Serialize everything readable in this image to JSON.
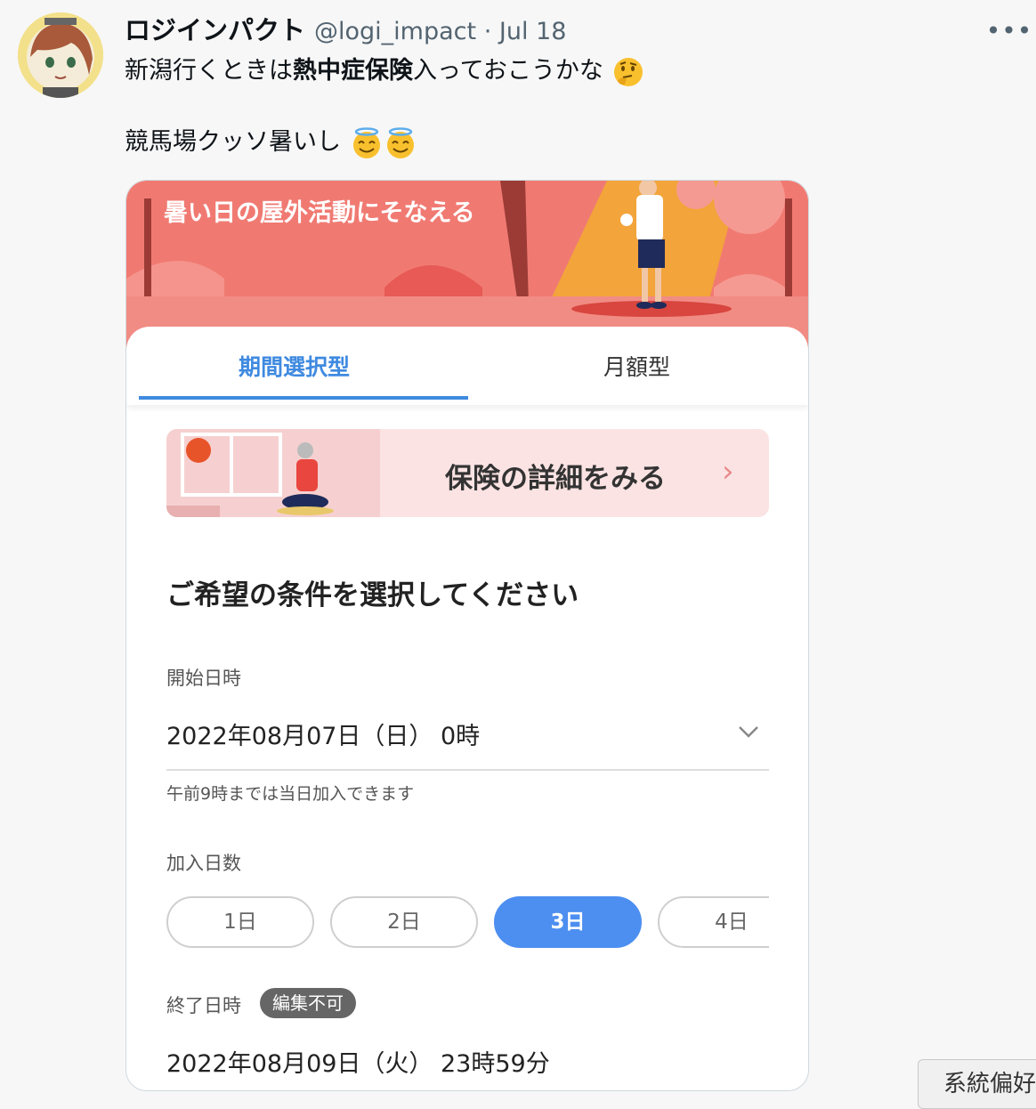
{
  "tweet": {
    "display_name": "ロジインパクト",
    "handle": "@logi_impact",
    "separator": "·",
    "date": "Jul 18",
    "more": "•••",
    "line1_a": "新潟行くときは",
    "line1_bold": "熱中症保険",
    "line1_b": "入っておこうかな",
    "line2": "競馬場クッソ暑いし"
  },
  "card": {
    "banner_title": "暑い日の屋外活動にそなえる",
    "tabs": [
      {
        "label": "期間選択型",
        "active": true
      },
      {
        "label": "月額型",
        "active": false
      }
    ],
    "details_link": "保険の詳細をみる",
    "details_chevron": "›",
    "heading": "ご希望の条件を選択してください",
    "start_label": "開始日時",
    "start_value": "2022年08月07日（日） 0時",
    "start_note": "午前9時までは当日加入できます",
    "days_label": "加入日数",
    "days_options": [
      "1日",
      "2日",
      "3日",
      "4日"
    ],
    "days_selected": "3日",
    "end_label": "終了日時",
    "end_badge": "編集不可",
    "end_value": "2022年08月09日（火） 23時59分"
  },
  "system_button": "系統偏好",
  "colors": {
    "accent_blue": "#3f8ae0",
    "selected_pill": "#4d8ff0",
    "banner_red": "#f07a72"
  }
}
